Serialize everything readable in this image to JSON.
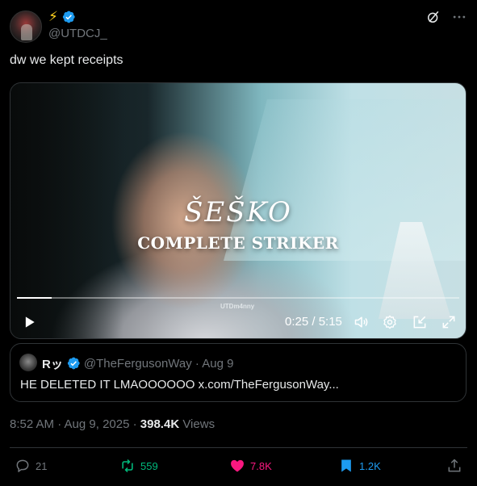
{
  "author": {
    "emoji": "⚡",
    "handle": "@UTDCJ_"
  },
  "tweet": {
    "text": "dw we kept receipts"
  },
  "video": {
    "overlay_line1": "ŠEŠKO",
    "overlay_line2": "COMPLETE STRIKER",
    "watermark": "UTDm4nny",
    "time_current": "0:25",
    "time_total": "5:15",
    "time_display": "0:25 / 5:15",
    "progress_fraction": 0.079
  },
  "quote": {
    "name": "Rッ",
    "handle_date": "@TheFergusonWay · Aug 9",
    "text": "HE DELETED IT LMAOOOOOO x.com/TheFergusonWay..."
  },
  "meta": {
    "time": "8:52 AM · Aug 9, 2025 · ",
    "views_count": "398.4K",
    "views_label": " Views"
  },
  "actions": {
    "replies": "21",
    "reposts": "559",
    "likes": "7.8K",
    "bookmarks": "1.2K"
  },
  "colors": {
    "background": "#000000",
    "muted": "#71767b",
    "verified": "#1d9bf0",
    "repost": "#00ba7c",
    "like": "#f91880",
    "bookmark": "#1d9bf0"
  },
  "icons": [
    "grok-icon",
    "more-icon",
    "verified-icon",
    "play-icon",
    "volume-icon",
    "settings-icon",
    "pip-icon",
    "fullscreen-icon",
    "reply-icon",
    "repost-icon",
    "like-icon",
    "bookmark-icon",
    "share-icon"
  ]
}
